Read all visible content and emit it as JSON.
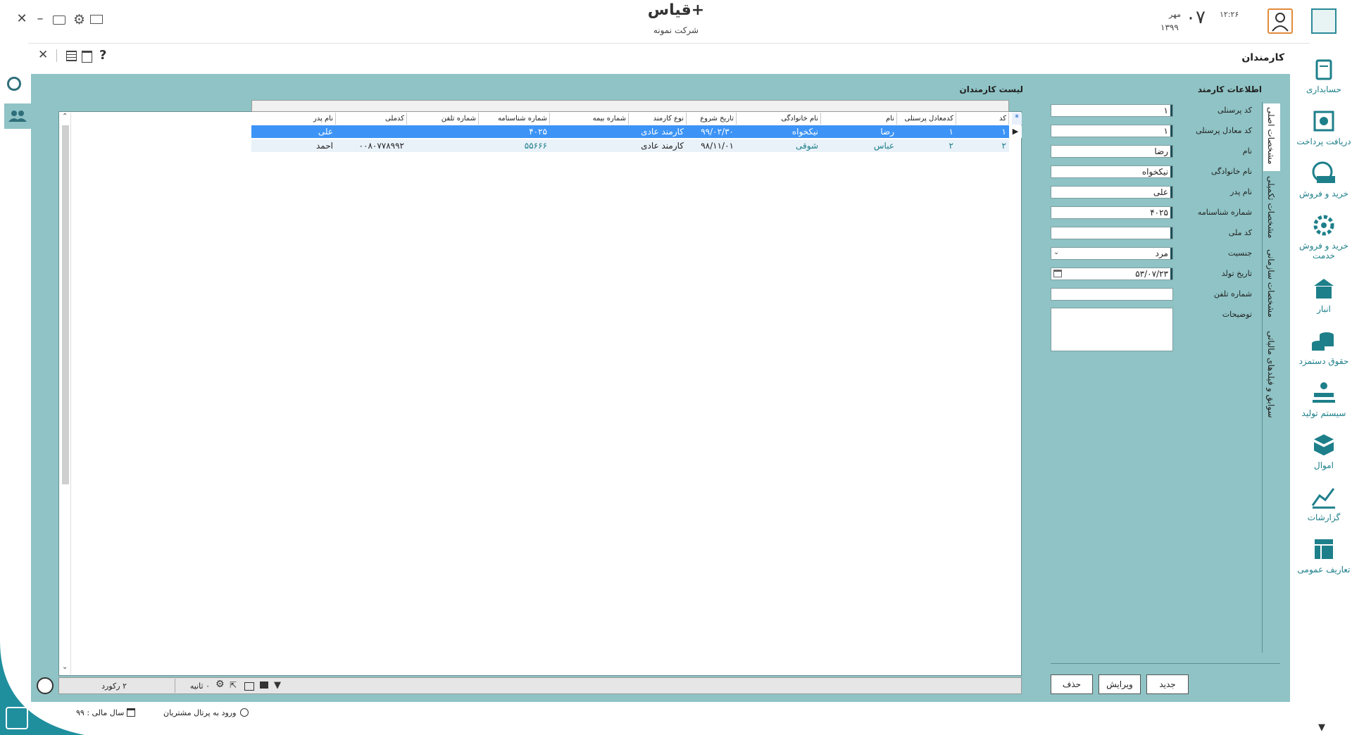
{
  "header": {
    "app_title": "قیاس+",
    "company": "شرکت نمونه",
    "clock": "۱۲:۲۶",
    "day": "۰۷",
    "month": "مهر",
    "year": "۱۳۹۹"
  },
  "toolbar": {
    "help_label": "?"
  },
  "page": {
    "title": "کارمندان"
  },
  "sidebar": {
    "items": [
      {
        "label": "حسابداری",
        "icon": "accounting-icon"
      },
      {
        "label": "دریافت پرداخت",
        "icon": "payment-icon"
      },
      {
        "label": "خرید و فروش",
        "icon": "sales-icon"
      },
      {
        "label": "خرید و فروش خدمت",
        "icon": "service-icon"
      },
      {
        "label": "انبار",
        "icon": "warehouse-icon"
      },
      {
        "label": "حقوق دستمزد",
        "icon": "payroll-icon"
      },
      {
        "label": "سیستم تولید",
        "icon": "production-icon"
      },
      {
        "label": "اموال",
        "icon": "assets-icon"
      },
      {
        "label": "گزارشات",
        "icon": "reports-icon"
      },
      {
        "label": "تعاریف عمومی",
        "icon": "definitions-icon"
      }
    ]
  },
  "tabs": [
    "مشخصات اصلی",
    "مشخصات تکمیلی",
    "مشخصات سازمانی",
    "سوابق و فیلدهای مالیاتی"
  ],
  "form": {
    "title": "اطلاعات کارمند",
    "labels": {
      "code": "کد پرسنلی",
      "equiv_code": "کد معادل پرسنلی",
      "name": "نام",
      "family": "نام خانوادگی",
      "father": "نام پدر",
      "id_no": "شماره شناسنامه",
      "national_code": "کد ملی",
      "gender": "جنسیت",
      "birth_date": "تاریخ تولد",
      "phone": "شماره تلفن",
      "description": "توضیحات"
    },
    "values": {
      "code": "۱",
      "equiv_code": "۱",
      "name": "رضا",
      "family": "نیکخواه",
      "father": "علی",
      "id_no": "۴۰۲۵",
      "national_code": "",
      "gender": "مرد",
      "birth_date": "۵۳/۰۷/۲۳",
      "phone": "",
      "description": ""
    }
  },
  "list": {
    "title": "لیست کارمندان",
    "columns": [
      "کد",
      "کدمعادل پرسنلی",
      "نام",
      "نام خانوادگی",
      "تاریخ شروع",
      "نوع کارمند",
      "شماره بیمه",
      "شماره شناسنامه",
      "شماره تلفن",
      "کدملی",
      "نام پدر"
    ],
    "rows": [
      [
        "۱",
        "۱",
        "رضا",
        "نیکخواه",
        "۹۹/۰۲/۳۰",
        "کارمند عادی",
        "",
        "۴۰۲۵",
        "",
        "",
        "علی"
      ],
      [
        "۲",
        "۲",
        "عباس",
        "شوقی",
        "۹۸/۱۱/۰۱",
        "کارمند عادی",
        "",
        "۵۵۶۶۶",
        "",
        "۰۰۸۰۷۷۸۹۹۲",
        "احمد"
      ]
    ],
    "selected_row": 0,
    "new_row_marker": "*",
    "record_count": "۲ رکورد",
    "timer": "۰ ثانیه"
  },
  "actions": {
    "new": "جدید",
    "edit": "ویرایش",
    "delete": "حذف"
  },
  "status": {
    "portal": "ورود به پرتال مشتریان",
    "fiscal_year": "سال مالی : ۹۹"
  },
  "colors": {
    "panel": "#8fc3c5",
    "accent": "#1d7f8a",
    "selected": "#3d94f6"
  }
}
